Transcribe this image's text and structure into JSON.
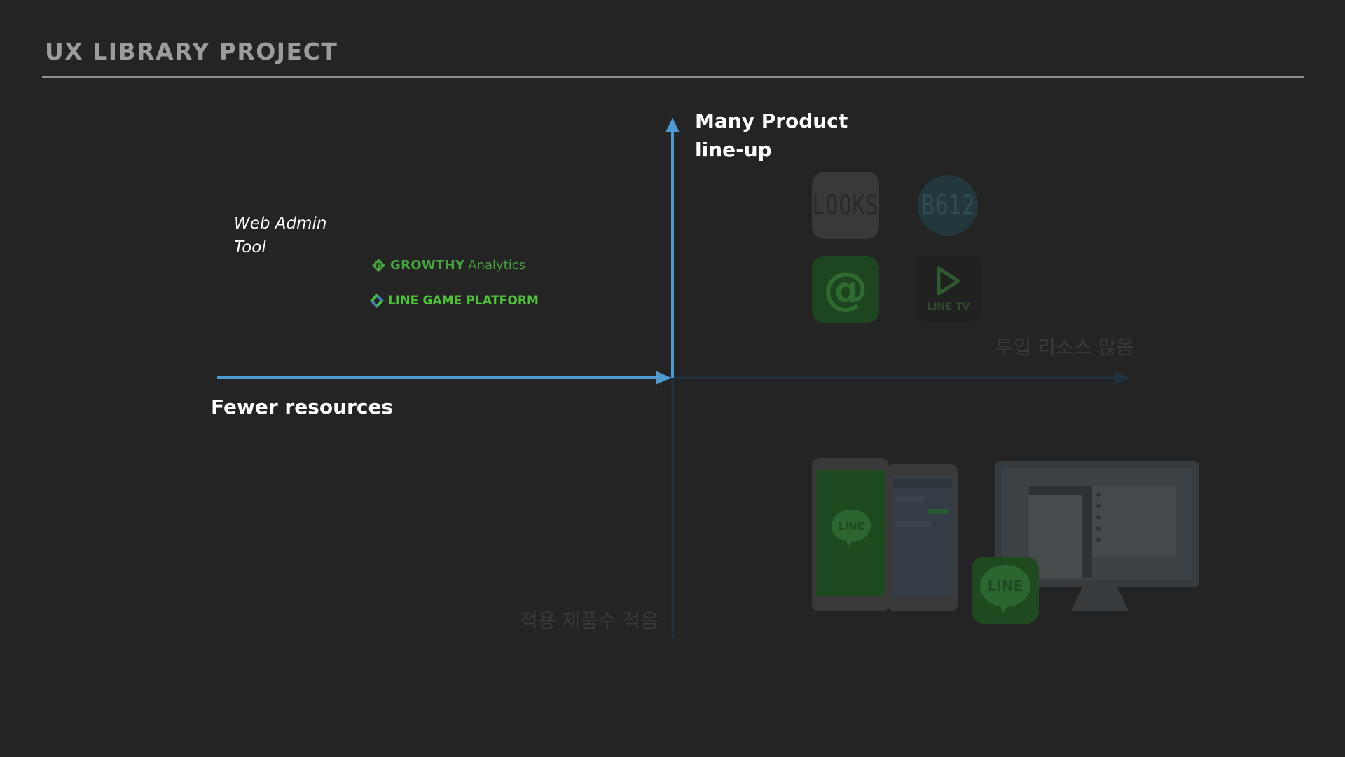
{
  "header": {
    "title": "UX LIBRARY PROJECT"
  },
  "diagram": {
    "y_axis_top_label": [
      "Many Product",
      "line-up"
    ],
    "x_axis_left_label": "Fewer resources",
    "x_axis_right_label_ko": "투입 리소스 많음",
    "y_axis_bottom_label_ko": "적용 제품수 적음",
    "left_quadrant_items": {
      "web_admin_tool": [
        "Web Admin",
        "Tool"
      ],
      "growthy": {
        "name": "GROWTHY",
        "suffix": "Analytics"
      },
      "line_game_platform": "LINE GAME PLATFORM"
    },
    "right_quadrant_apps": {
      "looks": "LOOKS",
      "b612": "B612",
      "at_sign": "@",
      "line_tv": "LINE TV",
      "line_phone": "LINE",
      "line_desktop": "LINE"
    }
  },
  "colors": {
    "background": "#242424",
    "axis_active": "#4e9ad2",
    "axis_faded": "#1f3342",
    "brand_green": "#47a33d"
  }
}
